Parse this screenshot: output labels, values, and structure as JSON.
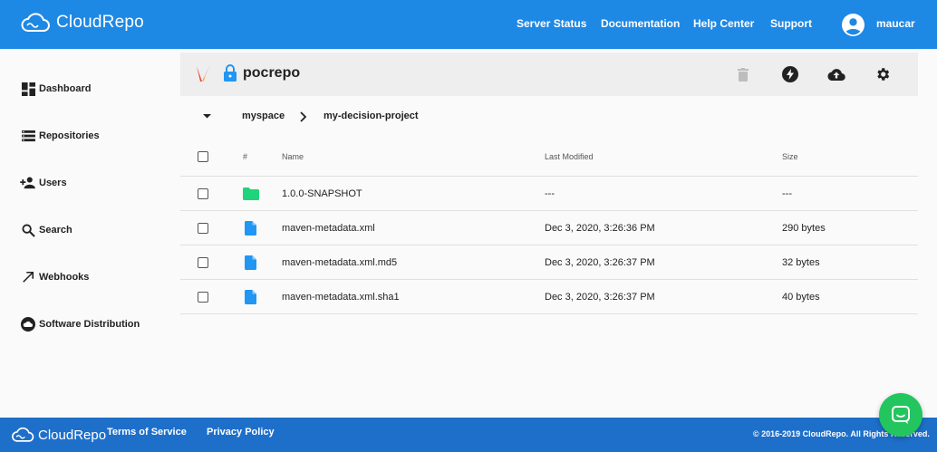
{
  "brand": {
    "name": "CloudRepo"
  },
  "header": {
    "nav": [
      "Server Status",
      "Documentation",
      "Help Center",
      "Support"
    ],
    "user_name": "maucar"
  },
  "sidebar": {
    "items": [
      {
        "label": "Dashboard",
        "icon": "dashboard-icon"
      },
      {
        "label": "Repositories",
        "icon": "list-icon"
      },
      {
        "label": "Users",
        "icon": "person-add-icon"
      },
      {
        "label": "Search",
        "icon": "search-icon"
      },
      {
        "label": "Webhooks",
        "icon": "arrow-up-right-icon"
      },
      {
        "label": "Software Distribution",
        "icon": "cloud-icon"
      }
    ]
  },
  "repo": {
    "name": "pocrepo",
    "actions": [
      "delete-icon",
      "bolt-icon",
      "cloud-upload-icon",
      "gear-icon"
    ]
  },
  "breadcrumb": [
    "myspace",
    "my-decision-project"
  ],
  "table": {
    "columns": [
      "#",
      "Name",
      "Last Modified",
      "Size"
    ],
    "rows": [
      {
        "type": "folder",
        "name": "1.0.0-SNAPSHOT",
        "modified": "---",
        "size": "---"
      },
      {
        "type": "file",
        "name": "maven-metadata.xml",
        "modified": "Dec 3, 2020, 3:26:36 PM",
        "size": "290 bytes"
      },
      {
        "type": "file",
        "name": "maven-metadata.xml.md5",
        "modified": "Dec 3, 2020, 3:26:37 PM",
        "size": "32 bytes"
      },
      {
        "type": "file",
        "name": "maven-metadata.xml.sha1",
        "modified": "Dec 3, 2020, 3:26:37 PM",
        "size": "40 bytes"
      }
    ]
  },
  "footer": {
    "links": [
      "Terms of Service",
      "Privacy Policy"
    ],
    "copyright": "© 2016-2019 CloudRepo. All Rights Reserved."
  },
  "colors": {
    "header_bg": "#1e88e5",
    "footer_bg": "#1e6fc9",
    "folder": "#1fd47a",
    "file": "#2196f3",
    "chat": "#23c55e"
  }
}
